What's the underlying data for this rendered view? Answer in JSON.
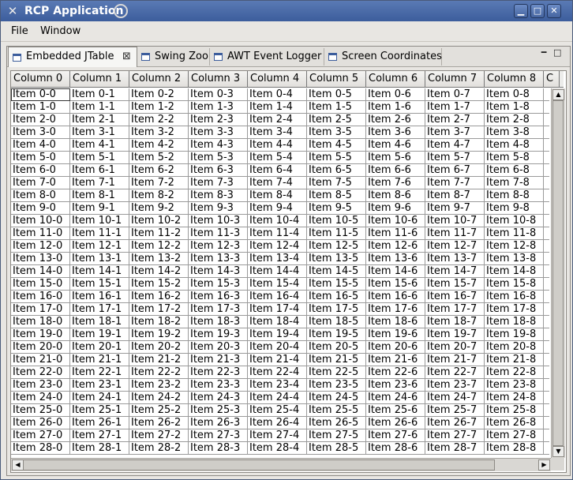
{
  "window": {
    "title": "RCP Application",
    "controls": {
      "minimize": "▁",
      "maximize": "□",
      "close": "✕"
    }
  },
  "menu": [
    "File",
    "Window"
  ],
  "tabs": [
    {
      "label": "Embedded JTable",
      "active": true,
      "close": "⊠"
    },
    {
      "label": "Swing Zoo",
      "active": false
    },
    {
      "label": "AWT Event Logger",
      "active": false
    },
    {
      "label": "Screen Coordinates",
      "active": false
    }
  ],
  "view_controls": {
    "minimize": "━",
    "maximize": "□"
  },
  "table": {
    "columns": [
      "Column 0",
      "Column 1",
      "Column 2",
      "Column 3",
      "Column 4",
      "Column 5",
      "Column 6",
      "Column 7",
      "Column 8",
      "C"
    ],
    "rows": [
      [
        "Item 0-0",
        "Item 0-1",
        "Item 0-2",
        "Item 0-3",
        "Item 0-4",
        "Item 0-5",
        "Item 0-6",
        "Item 0-7",
        "Item 0-8"
      ],
      [
        "Item 1-0",
        "Item 1-1",
        "Item 1-2",
        "Item 1-3",
        "Item 1-4",
        "Item 1-5",
        "Item 1-6",
        "Item 1-7",
        "Item 1-8"
      ],
      [
        "Item 2-0",
        "Item 2-1",
        "Item 2-2",
        "Item 2-3",
        "Item 2-4",
        "Item 2-5",
        "Item 2-6",
        "Item 2-7",
        "Item 2-8"
      ],
      [
        "Item 3-0",
        "Item 3-1",
        "Item 3-2",
        "Item 3-3",
        "Item 3-4",
        "Item 3-5",
        "Item 3-6",
        "Item 3-7",
        "Item 3-8"
      ],
      [
        "Item 4-0",
        "Item 4-1",
        "Item 4-2",
        "Item 4-3",
        "Item 4-4",
        "Item 4-5",
        "Item 4-6",
        "Item 4-7",
        "Item 4-8"
      ],
      [
        "Item 5-0",
        "Item 5-1",
        "Item 5-2",
        "Item 5-3",
        "Item 5-4",
        "Item 5-5",
        "Item 5-6",
        "Item 5-7",
        "Item 5-8"
      ],
      [
        "Item 6-0",
        "Item 6-1",
        "Item 6-2",
        "Item 6-3",
        "Item 6-4",
        "Item 6-5",
        "Item 6-6",
        "Item 6-7",
        "Item 6-8"
      ],
      [
        "Item 7-0",
        "Item 7-1",
        "Item 7-2",
        "Item 7-3",
        "Item 7-4",
        "Item 7-5",
        "Item 7-6",
        "Item 7-7",
        "Item 7-8"
      ],
      [
        "Item 8-0",
        "Item 8-1",
        "Item 8-2",
        "Item 8-3",
        "Item 8-4",
        "Item 8-5",
        "Item 8-6",
        "Item 8-7",
        "Item 8-8"
      ],
      [
        "Item 9-0",
        "Item 9-1",
        "Item 9-2",
        "Item 9-3",
        "Item 9-4",
        "Item 9-5",
        "Item 9-6",
        "Item 9-7",
        "Item 9-8"
      ],
      [
        "Item 10-0",
        "Item 10-1",
        "Item 10-2",
        "Item 10-3",
        "Item 10-4",
        "Item 10-5",
        "Item 10-6",
        "Item 10-7",
        "Item 10-8"
      ],
      [
        "Item 11-0",
        "Item 11-1",
        "Item 11-2",
        "Item 11-3",
        "Item 11-4",
        "Item 11-5",
        "Item 11-6",
        "Item 11-7",
        "Item 11-8"
      ],
      [
        "Item 12-0",
        "Item 12-1",
        "Item 12-2",
        "Item 12-3",
        "Item 12-4",
        "Item 12-5",
        "Item 12-6",
        "Item 12-7",
        "Item 12-8"
      ],
      [
        "Item 13-0",
        "Item 13-1",
        "Item 13-2",
        "Item 13-3",
        "Item 13-4",
        "Item 13-5",
        "Item 13-6",
        "Item 13-7",
        "Item 13-8"
      ],
      [
        "Item 14-0",
        "Item 14-1",
        "Item 14-2",
        "Item 14-3",
        "Item 14-4",
        "Item 14-5",
        "Item 14-6",
        "Item 14-7",
        "Item 14-8"
      ],
      [
        "Item 15-0",
        "Item 15-1",
        "Item 15-2",
        "Item 15-3",
        "Item 15-4",
        "Item 15-5",
        "Item 15-6",
        "Item 15-7",
        "Item 15-8"
      ],
      [
        "Item 16-0",
        "Item 16-1",
        "Item 16-2",
        "Item 16-3",
        "Item 16-4",
        "Item 16-5",
        "Item 16-6",
        "Item 16-7",
        "Item 16-8"
      ],
      [
        "Item 17-0",
        "Item 17-1",
        "Item 17-2",
        "Item 17-3",
        "Item 17-4",
        "Item 17-5",
        "Item 17-6",
        "Item 17-7",
        "Item 17-8"
      ],
      [
        "Item 18-0",
        "Item 18-1",
        "Item 18-2",
        "Item 18-3",
        "Item 18-4",
        "Item 18-5",
        "Item 18-6",
        "Item 18-7",
        "Item 18-8"
      ],
      [
        "Item 19-0",
        "Item 19-1",
        "Item 19-2",
        "Item 19-3",
        "Item 19-4",
        "Item 19-5",
        "Item 19-6",
        "Item 19-7",
        "Item 19-8"
      ],
      [
        "Item 20-0",
        "Item 20-1",
        "Item 20-2",
        "Item 20-3",
        "Item 20-4",
        "Item 20-5",
        "Item 20-6",
        "Item 20-7",
        "Item 20-8"
      ],
      [
        "Item 21-0",
        "Item 21-1",
        "Item 21-2",
        "Item 21-3",
        "Item 21-4",
        "Item 21-5",
        "Item 21-6",
        "Item 21-7",
        "Item 21-8"
      ],
      [
        "Item 22-0",
        "Item 22-1",
        "Item 22-2",
        "Item 22-3",
        "Item 22-4",
        "Item 22-5",
        "Item 22-6",
        "Item 22-7",
        "Item 22-8"
      ],
      [
        "Item 23-0",
        "Item 23-1",
        "Item 23-2",
        "Item 23-3",
        "Item 23-4",
        "Item 23-5",
        "Item 23-6",
        "Item 23-7",
        "Item 23-8"
      ],
      [
        "Item 24-0",
        "Item 24-1",
        "Item 24-2",
        "Item 24-3",
        "Item 24-4",
        "Item 24-5",
        "Item 24-6",
        "Item 24-7",
        "Item 24-8"
      ],
      [
        "Item 25-0",
        "Item 25-1",
        "Item 25-2",
        "Item 25-3",
        "Item 25-4",
        "Item 25-5",
        "Item 25-6",
        "Item 25-7",
        "Item 25-8"
      ],
      [
        "Item 26-0",
        "Item 26-1",
        "Item 26-2",
        "Item 26-3",
        "Item 26-4",
        "Item 26-5",
        "Item 26-6",
        "Item 26-7",
        "Item 26-8"
      ],
      [
        "Item 27-0",
        "Item 27-1",
        "Item 27-2",
        "Item 27-3",
        "Item 27-4",
        "Item 27-5",
        "Item 27-6",
        "Item 27-7",
        "Item 27-8"
      ],
      [
        "Item 28-0",
        "Item 28-1",
        "Item 28-2",
        "Item 28-3",
        "Item 28-4",
        "Item 28-5",
        "Item 28-6",
        "Item 28-7",
        "Item 28-8"
      ]
    ]
  },
  "scroll": {
    "up": "▲",
    "down": "▼",
    "left": "◀",
    "right": "▶"
  }
}
